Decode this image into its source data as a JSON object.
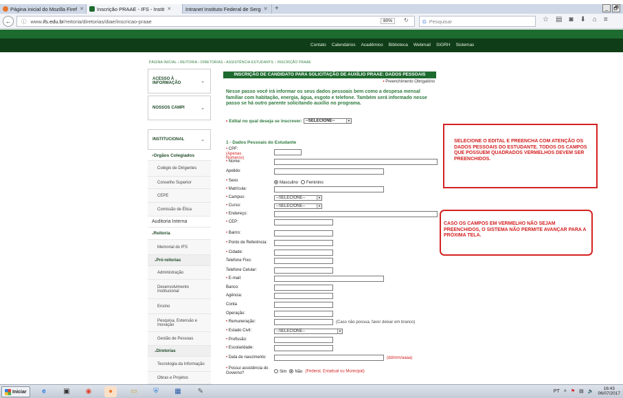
{
  "browser": {
    "tabs": [
      {
        "label": "Página inicial do Mozilla Firef",
        "color": "#e8762c"
      },
      {
        "label": "Inscrição PRAAE - IFS - Instit",
        "color": "#1e6b2f"
      },
      {
        "label": "Intranet Instituto Federal de Serg",
        "color": "#1e6b2f"
      }
    ],
    "new_tab": "+",
    "window_controls": [
      "_",
      "🗗"
    ],
    "url_prefix": "www.",
    "url_domain": "ifs.edu.br",
    "url_path": "/reitoria/diretorias/diae/inscricao-praae",
    "zoom": "80%",
    "search_placeholder": "Pesquisar"
  },
  "site": {
    "top_menu": [
      "Contato",
      "Calendários",
      "Acadêmico",
      "Biblioteca",
      "Webmail",
      "SIGRH",
      "Sistemas"
    ],
    "breadcrumb": "PÁGINA INICIAL › REITORIA › DIRETORIAS › ASSISTÊNCIA ESTUDANTIL › INSCRIÇÃO PRAAE"
  },
  "sidebar": {
    "heads": [
      "ACESSO À INFORMAÇÃO",
      "NOSSOS CAMPI",
      "INSTITUCIONAL"
    ],
    "items": [
      {
        "label": "Orgãos Colegiados",
        "kind": "section"
      },
      {
        "label": "Colégio de Dirigentes",
        "kind": "item"
      },
      {
        "label": "Conselho Superior",
        "kind": "item"
      },
      {
        "label": "CEPE",
        "kind": "item"
      },
      {
        "label": "Comissão de Ética",
        "kind": "item"
      },
      {
        "label": "Auditoria Interna",
        "kind": "plain"
      },
      {
        "label": "Reitoria",
        "kind": "section"
      },
      {
        "label": "Memorial do IFS",
        "kind": "item"
      },
      {
        "label": "Pró-reitorias",
        "kind": "sub"
      },
      {
        "label": "Administração",
        "kind": "item"
      },
      {
        "label": "Desenvolvimento Institucional",
        "kind": "item"
      },
      {
        "label": "Ensino",
        "kind": "item"
      },
      {
        "label": "Pesquisa, Extensão e Inovação",
        "kind": "item"
      },
      {
        "label": "Gestão de Pessoas",
        "kind": "item"
      },
      {
        "label": "Diretorias",
        "kind": "sub"
      },
      {
        "label": "Tecnologia da Informação",
        "kind": "item"
      },
      {
        "label": "Obras e Projetos",
        "kind": "item"
      }
    ]
  },
  "form": {
    "title": "INSCRIÇÃO DE CANDIDATO PARA SOLICITAÇÃO DE AUXÍLIO PRAAE: DADOS PESSOAIS",
    "required_note": "Preenchimento Obrigatório",
    "intro": "Nesse passo você irá informar os seus dados pessoais bem como a despesa mensal familiar com habitação, energia, água, esgoto e telefone. Também será informado nesse passo se há outro parente solicitando auxílio no programa.",
    "edital_label": "Edital no qual deseja se inscrever:",
    "edital_value": "--SELECIONE--",
    "section_title": "1 - Dados Pessoais do Estudante",
    "cpf_hint": "(Apenas Números)",
    "fields": [
      {
        "label": "CPF:",
        "req": true
      },
      {
        "label": "Nome:",
        "req": true
      },
      {
        "label": "Apelido:",
        "req": false
      },
      {
        "label": "Sexo",
        "req": true
      },
      {
        "label": "Matrícula:",
        "req": true
      },
      {
        "label": "Campus:",
        "req": true
      },
      {
        "label": "Curso:",
        "req": true
      },
      {
        "label": "Endereço:",
        "req": true
      },
      {
        "label": "CEP:",
        "req": true
      },
      {
        "label": "Bairro:",
        "req": true
      },
      {
        "label": "Ponto de Referência:",
        "req": true
      },
      {
        "label": "Cidade:",
        "req": true
      },
      {
        "label": "Telefone Fixo:",
        "req": false
      },
      {
        "label": "Telefone Celular:",
        "req": false
      },
      {
        "label": "E-mail:",
        "req": true
      },
      {
        "label": "Banco:",
        "req": false
      },
      {
        "label": "Agência:",
        "req": false
      },
      {
        "label": "Conta",
        "req": false
      },
      {
        "label": "Operação:",
        "req": false
      },
      {
        "label": "Remuneração:",
        "req": true
      },
      {
        "label": "Estado Civil:",
        "req": true
      },
      {
        "label": "Profissão:",
        "req": true
      },
      {
        "label": "Escolaridade:",
        "req": true
      },
      {
        "label": "Data de nascimento:",
        "req": true
      },
      {
        "label": "Possui assistência do Governo?",
        "req": true
      }
    ],
    "sexo_options": [
      "Masculino",
      "Feminino"
    ],
    "select_placeholder": "--SELECIONE--",
    "remuneracao_note": "(Caso não possua, favor deixar em branco)",
    "date_note": "(dd/mm/aaaa)",
    "gov_options": [
      "Sim",
      "Não"
    ],
    "gov_note": "(Federal, Estadual ou Municipal)"
  },
  "annotations": [
    "SELECIONE O EDITAL E PREENCHA COM ATENÇÃO OS DADOS PESSOAIS DO ESTUDANTE. TODOS OS CAMPOS QUE POSSUEM QUADRADOS VERMELHOS DEVEM SER PREENCHIDOS.",
    "CASO OS CAMPOS EM VERMELHO NÃO SEJAM PREENCHIDOS, O SISTEMA NÃO PERMITE AVANÇAR PARA A PRÓXIMA TELA."
  ],
  "taskbar": {
    "start_label": "Iniciar",
    "lang": "PT",
    "time": "16:43",
    "date": "06/07/2017"
  },
  "colors": {
    "header_green": "#1e6b2f",
    "header_dark": "#0f3d17",
    "required_red": "#d42020",
    "text_green": "#2d7a3c"
  }
}
